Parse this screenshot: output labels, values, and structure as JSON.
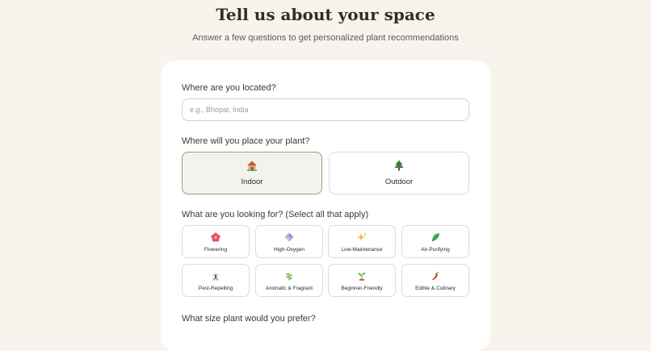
{
  "header": {
    "title": "Tell us about your space",
    "subtitle": "Answer a few questions to get personalized plant recommendations"
  },
  "location": {
    "question": "Where are you located?",
    "placeholder": "e.g., Bhopal, India",
    "value": ""
  },
  "placement": {
    "question": "Where will you place your plant?",
    "options": [
      {
        "label": "Indoor",
        "icon": "house-icon",
        "selected": true
      },
      {
        "label": "Outdoor",
        "icon": "tree-icon",
        "selected": false
      }
    ]
  },
  "looking_for": {
    "question": "What are you looking for? (Select all that apply)",
    "options": [
      {
        "label": "Flowering",
        "icon": "hibiscus-icon"
      },
      {
        "label": "High-Oxygen",
        "icon": "diamond-icon"
      },
      {
        "label": "Low-Maintenance",
        "icon": "sparkles-icon"
      },
      {
        "label": "Air-Purifying",
        "icon": "leaf-icon"
      },
      {
        "label": "Pest-Repelling",
        "icon": "mosquito-icon"
      },
      {
        "label": "Aromatic & Fragrant",
        "icon": "herb-icon"
      },
      {
        "label": "Beginner-Friendly",
        "icon": "seedling-icon"
      },
      {
        "label": "Edible & Culinary",
        "icon": "chili-pepper-icon"
      }
    ]
  },
  "size": {
    "question": "What size plant would you prefer?"
  },
  "colors": {
    "background": "#f8f4ed",
    "selected_border": "#96a079",
    "selected_fill": "#f3f3ee"
  }
}
